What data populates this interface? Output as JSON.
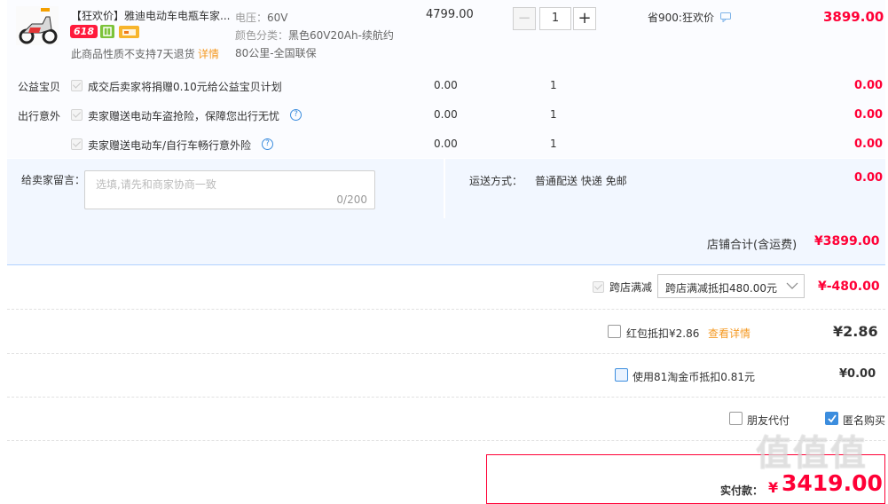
{
  "product": {
    "title": "【狂欢价】雅迪电动车电瓶车家...",
    "badge_618": "618",
    "no_return_note": "此商品性质不支持7天退货",
    "details_link": "详情",
    "spec_voltage_label": "电压：",
    "spec_voltage": "60V",
    "spec_color_label": "颜色分类：",
    "spec_color_line1": "黑色60V20Ah-续航约",
    "spec_color_line2": "80公里-全国联保",
    "unit_price": "4799.00",
    "quantity": "1",
    "discount_text": "省900:狂欢价",
    "subtotal": "3899.00"
  },
  "addons": [
    {
      "group": "公益宝贝",
      "text": "成交后卖家将捐赠0.10元给公益宝贝计划",
      "price": "0.00",
      "qty": "1",
      "subtotal": "0.00"
    },
    {
      "group": "出行意外",
      "text": "卖家赠送电动车盗抢险，保障您出行无忧",
      "price": "0.00",
      "qty": "1",
      "subtotal": "0.00"
    },
    {
      "group": "",
      "text": "卖家赠送电动车/自行车畅行意外险",
      "price": "0.00",
      "qty": "1",
      "subtotal": "0.00"
    }
  ],
  "message": {
    "label": "给卖家留言：",
    "placeholder": "选填,请先和商家协商一致",
    "counter": "0/200"
  },
  "shipping": {
    "label": "运送方式：",
    "value": "普通配送 快递 免邮",
    "fee": "0.00"
  },
  "store_total": {
    "label": "店铺合计(含运费)",
    "value": "¥3899.00"
  },
  "cross_store": {
    "label": "跨店满减",
    "select_value": "跨店满减抵扣480.00元",
    "amount": "¥-480.00"
  },
  "red_packet": {
    "label": "红包抵扣¥2.86",
    "link": "查看详情",
    "amount": "¥2.86"
  },
  "taojinbi": {
    "label": "使用81淘金币抵扣0.81元",
    "amount": "¥0.00"
  },
  "options": {
    "friend_pay": "朋友代付",
    "anonymous": "匿名购买"
  },
  "pay": {
    "label": "实付款：",
    "currency": "¥",
    "amount": "3419.00"
  },
  "watermark": "值 值 值",
  "colors": {
    "price_red": "#ff0036",
    "link_orange": "#f59a23",
    "blue_bg": "#f2f7ff",
    "checked_blue": "#3c8dde"
  }
}
